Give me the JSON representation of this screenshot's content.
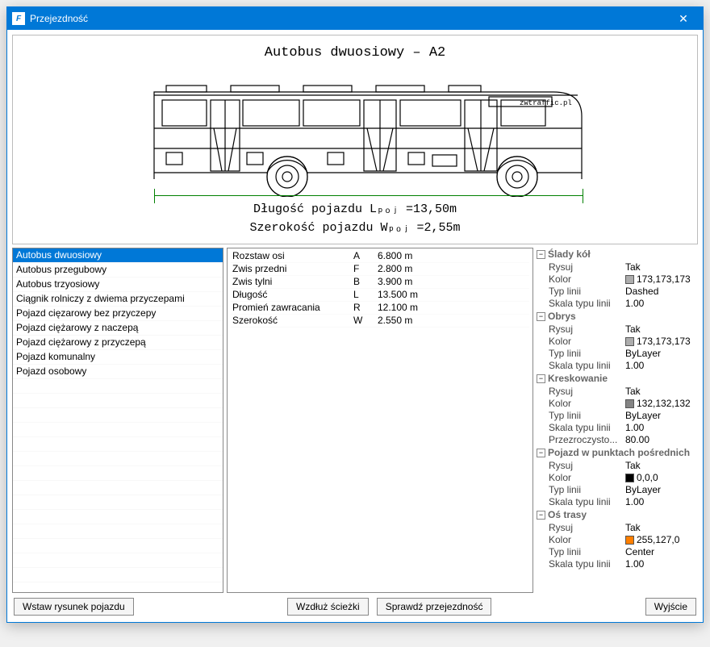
{
  "window": {
    "title": "Przejezdność"
  },
  "drawing": {
    "title": "Autobus dwuosiowy – A2",
    "watermark": "zwtraffic.pl",
    "dim_length": "Długość pojazdu Lₚₒⱼ =13,50m",
    "dim_width": "Szerokość pojazdu Wₚₒⱼ =2,55m"
  },
  "vehicle_list": [
    "Autobus dwuosiowy",
    "Autobus przegubowy",
    "Autobus trzyosiowy",
    "Ciągnik rolniczy z dwiema przyczepami",
    "Pojazd cięzarowy bez przyczepy",
    "Pojazd ciężarowy z naczepą",
    "Pojazd ciężarowy z przyczepą",
    "Pojazd komunalny",
    "Pojazd osobowy"
  ],
  "selected_vehicle": 0,
  "params": [
    {
      "name": "Rozstaw osi",
      "code": "A",
      "value": "6.800 m"
    },
    {
      "name": "Zwis przedni",
      "code": "F",
      "value": "2.800 m"
    },
    {
      "name": "Zwis tylni",
      "code": "B",
      "value": "3.900 m"
    },
    {
      "name": "Długość",
      "code": "L",
      "value": "13.500 m"
    },
    {
      "name": "Promień zawracania",
      "code": "R",
      "value": "12.100 m"
    },
    {
      "name": "Szerokość",
      "code": "W",
      "value": "2.550 m"
    }
  ],
  "prop_groups": [
    {
      "title": "Ślady kół",
      "rows": [
        {
          "k": "Rysuj",
          "v": "Tak"
        },
        {
          "k": "Kolor",
          "v": "173,173,173",
          "swatch": "#adadad"
        },
        {
          "k": "Typ linii",
          "v": "Dashed"
        },
        {
          "k": "Skala typu linii",
          "v": "1.00"
        }
      ]
    },
    {
      "title": "Obrys",
      "rows": [
        {
          "k": "Rysuj",
          "v": "Tak"
        },
        {
          "k": "Kolor",
          "v": "173,173,173",
          "swatch": "#adadad"
        },
        {
          "k": "Typ linii",
          "v": "ByLayer"
        },
        {
          "k": "Skala typu linii",
          "v": "1.00"
        }
      ]
    },
    {
      "title": "Kreskowanie",
      "rows": [
        {
          "k": "Rysuj",
          "v": "Tak"
        },
        {
          "k": "Kolor",
          "v": "132,132,132",
          "swatch": "#848484"
        },
        {
          "k": "Typ linii",
          "v": "ByLayer"
        },
        {
          "k": "Skala typu linii",
          "v": "1.00"
        },
        {
          "k": "Przezroczysto...",
          "v": "80.00"
        }
      ]
    },
    {
      "title": "Pojazd w punktach pośrednich",
      "rows": [
        {
          "k": "Rysuj",
          "v": "Tak"
        },
        {
          "k": "Kolor",
          "v": "0,0,0",
          "swatch": "#000000"
        },
        {
          "k": "Typ linii",
          "v": "ByLayer"
        },
        {
          "k": "Skala typu linii",
          "v": "1.00"
        }
      ]
    },
    {
      "title": "Oś trasy",
      "rows": [
        {
          "k": "Rysuj",
          "v": "Tak"
        },
        {
          "k": "Kolor",
          "v": "255,127,0",
          "swatch": "#ff7f00"
        },
        {
          "k": "Typ linii",
          "v": "Center"
        },
        {
          "k": "Skala typu linii",
          "v": "1.00"
        }
      ]
    }
  ],
  "buttons": {
    "insert": "Wstaw rysunek pojazdu",
    "along": "Wzdłuż ścieżki",
    "check": "Sprawdź przejezdność",
    "exit": "Wyjście"
  }
}
